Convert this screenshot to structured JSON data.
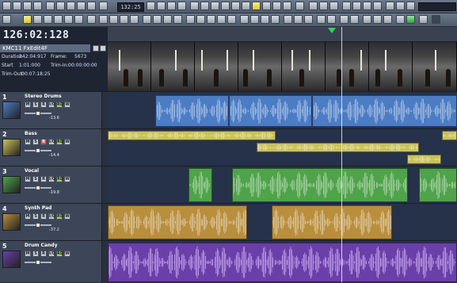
{
  "toolbar": {
    "transport_time": "132:25"
  },
  "transport": {
    "main_timecode": "126:02:128"
  },
  "clip_info": {
    "name": "KMC11 FxEdit4F",
    "duration_label": "Duration",
    "duration_value": "242:04:917",
    "frame_label": "Frame:",
    "frame_value": "5673",
    "start_label": "Start",
    "start_value": "1:01:000",
    "trim_in_label": "Trim-In:",
    "trim_in_value": "00:00:00:00",
    "trim_out_label": "Trim-Out:",
    "trim_out_value": "00:07:18:25"
  },
  "tracks": [
    {
      "number": "1",
      "name": "Stereo Drums",
      "volume": "-13.6",
      "color": "#4b7cc4",
      "icon": "drums-icon"
    },
    {
      "number": "2",
      "name": "Bass",
      "volume": "-14.4",
      "color": "#c9c25a",
      "icon": "guitar-icon"
    },
    {
      "number": "3",
      "name": "Vocal",
      "volume": "-19.8",
      "color": "#4fa34a",
      "icon": "microphone-icon"
    },
    {
      "number": "4",
      "name": "Synth Pad",
      "volume": "-37.2",
      "color": "#b98e3c",
      "icon": "keyboard-icon"
    },
    {
      "number": "5",
      "name": "Drum Candy",
      "volume": "",
      "color": "#6a3fa8",
      "icon": "piano-icon"
    }
  ],
  "track_buttons": {
    "mute": "M",
    "solo": "S",
    "rec": "R",
    "input": "I/O",
    "read": "RD",
    "write": "W"
  }
}
